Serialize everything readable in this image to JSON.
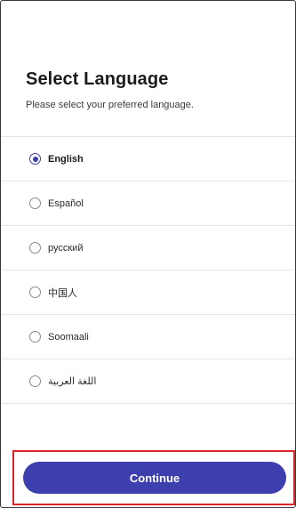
{
  "header": {
    "title": "Select Language",
    "subtitle": "Please select your preferred language."
  },
  "languages": [
    {
      "label": "English",
      "selected": true
    },
    {
      "label": "Español",
      "selected": false
    },
    {
      "label": "русский",
      "selected": false
    },
    {
      "label": "中国人",
      "selected": false
    },
    {
      "label": "Soomaali",
      "selected": false
    },
    {
      "label": "اللغة العربية",
      "selected": false
    }
  ],
  "footer": {
    "continue_label": "Continue"
  },
  "colors": {
    "accent": "#3d3fae",
    "highlight_border": "#d8262b"
  }
}
